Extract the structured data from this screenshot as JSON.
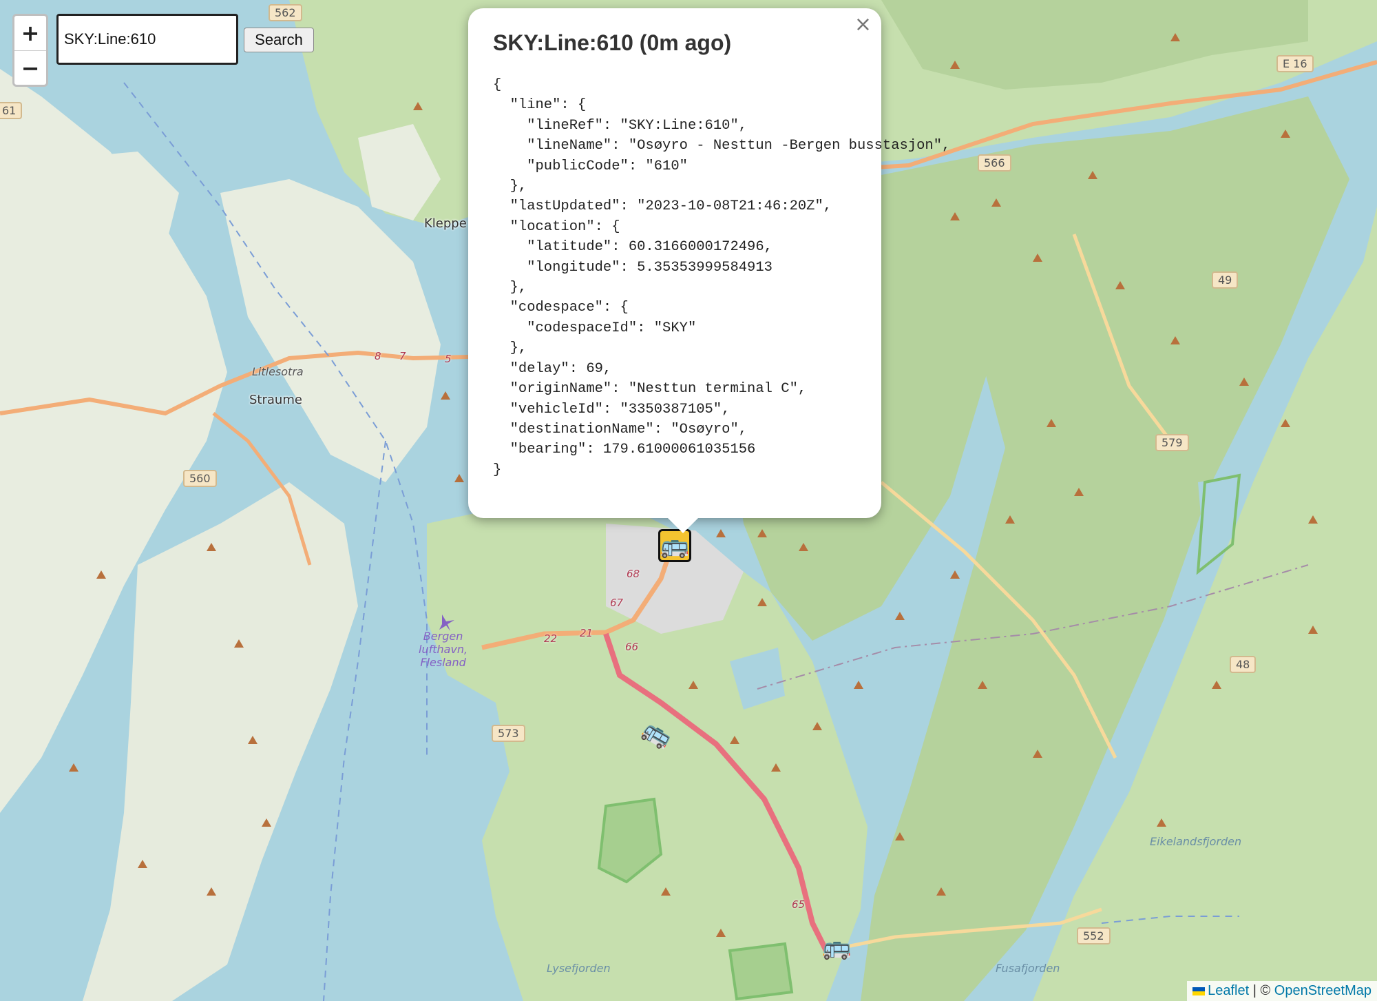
{
  "search": {
    "value": "SKY:Line:610",
    "button_label": "Search"
  },
  "zoom": {
    "in_label": "+",
    "out_label": "−"
  },
  "popup": {
    "title": "SKY:Line:610 (0m ago)",
    "close_label": "×",
    "json_text": "{\n  \"line\": {\n    \"lineRef\": \"SKY:Line:610\",\n    \"lineName\": \"Osøyro - Nesttun -Bergen busstasjon\",\n    \"publicCode\": \"610\"\n  },\n  \"lastUpdated\": \"2023-10-08T21:46:20Z\",\n  \"location\": {\n    \"latitude\": 60.3166000172496,\n    \"longitude\": 5.35353999584913\n  },\n  \"codespace\": {\n    \"codespaceId\": \"SKY\"\n  },\n  \"delay\": 69,\n  \"originName\": \"Nesttun terminal C\",\n  \"vehicleId\": \"3350387105\",\n  \"destinationName\": \"Osøyro\",\n  \"bearing\": 179.61000061035156\n}"
  },
  "map": {
    "places": {
      "kleppe": "Kleppe",
      "litlesotra": "Litlesotra",
      "straume": "Straume"
    },
    "airport": {
      "line1": "Bergen",
      "line2": "lufthavn,",
      "line3": "Flesland"
    },
    "water": {
      "eikelandsfjorden": "Eikelandsfjorden",
      "lysefjorden": "Lysefjorden",
      "fusafjorden": "Fusafjorden"
    },
    "shields": {
      "s562": "562",
      "s61": "61",
      "e16": "E 16",
      "s566": "566",
      "s49": "49",
      "s579": "579",
      "s560": "560",
      "s48": "48",
      "s573": "573",
      "s552": "552"
    },
    "route_numbers": {
      "r8": "8",
      "r7": "7",
      "r5": "5",
      "r68": "68",
      "r67": "67",
      "r22": "22",
      "r21": "21",
      "r66": "66",
      "r65": "65"
    }
  },
  "attribution": {
    "leaflet": "Leaflet",
    "separator": "| ©",
    "osm": "OpenStreetMap"
  },
  "colors": {
    "water": "#aad3df",
    "land": "#f2efe9",
    "forest": "#add19e",
    "motorway": "#e8707e",
    "primary": "#f3ad77"
  }
}
